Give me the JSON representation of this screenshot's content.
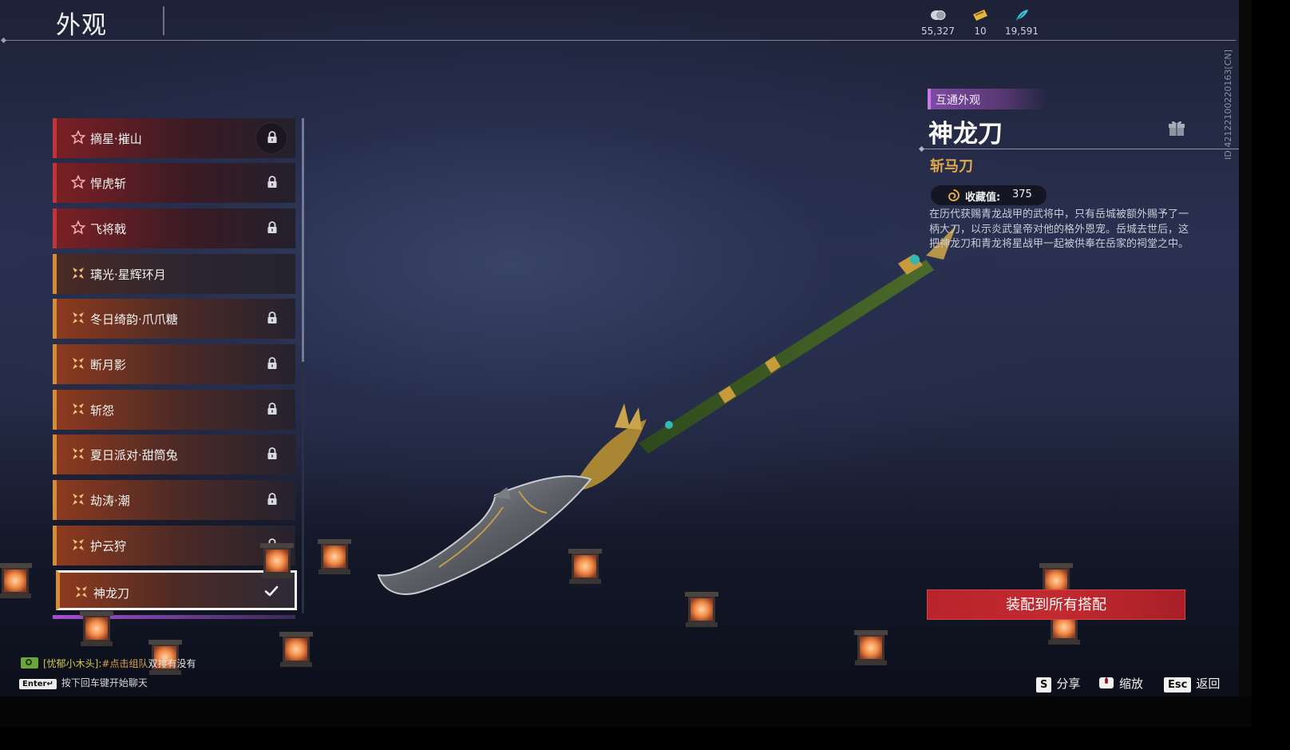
{
  "header": {
    "title": "外观",
    "currencies": [
      {
        "icon": "silver-coin-icon",
        "value": "55,327"
      },
      {
        "icon": "ticket-icon",
        "value": "10"
      },
      {
        "icon": "feather-icon",
        "value": "19,591"
      }
    ],
    "id_text": "ID:42122100220163[CN]"
  },
  "skin_list": [
    {
      "name": "摘星·摧山",
      "rarity": "red",
      "locked": true
    },
    {
      "name": "悍虎斩",
      "rarity": "red",
      "locked": true
    },
    {
      "name": "飞将戟",
      "rarity": "red",
      "locked": true
    },
    {
      "name": "璃光·星辉环月",
      "rarity": "gold",
      "locked": false
    },
    {
      "name": "冬日绮韵·爪爪糖",
      "rarity": "gold",
      "locked": true
    },
    {
      "name": "断月影",
      "rarity": "gold",
      "locked": true
    },
    {
      "name": "斩怨",
      "rarity": "gold",
      "locked": true
    },
    {
      "name": "夏日派对·甜筒兔",
      "rarity": "gold",
      "locked": true
    },
    {
      "name": "劫涛·潮",
      "rarity": "gold",
      "locked": true
    },
    {
      "name": "护云狩",
      "rarity": "gold",
      "locked": true
    },
    {
      "name": "神龙刀",
      "rarity": "gold",
      "locked": false,
      "selected": true
    }
  ],
  "detail": {
    "tag": "互通外观",
    "name": "神龙刀",
    "type": "斩马刀",
    "collection_label": "收藏值:",
    "collection_value": "375",
    "description": "在历代获赐青龙战甲的武将中，只有岳城被额外赐予了一柄大刀，以示炎武皇帝对他的格外恩宠。岳城去世后，这把神龙刀和青龙将星战甲一起被供奉在岳家的祠堂之中。",
    "equip_button": "装配到所有搭配"
  },
  "chat": {
    "user": "[忧郁小木头]:",
    "message": "#点击组队",
    "tail": "双排有没有",
    "enter_key": "Enter↵",
    "enter_hint": "按下回车键开始聊天"
  },
  "controls": [
    {
      "key": "S",
      "label": "分享"
    },
    {
      "key": "mouse-icon",
      "label": "缩放"
    },
    {
      "key": "Esc",
      "label": "返回"
    }
  ],
  "colors": {
    "red_rarity": "#c0343c",
    "gold_rarity": "#d48b3a",
    "accent_gold": "#e2a94a",
    "equip_red": "#b9232b",
    "shared_purple": "#c77be8"
  }
}
